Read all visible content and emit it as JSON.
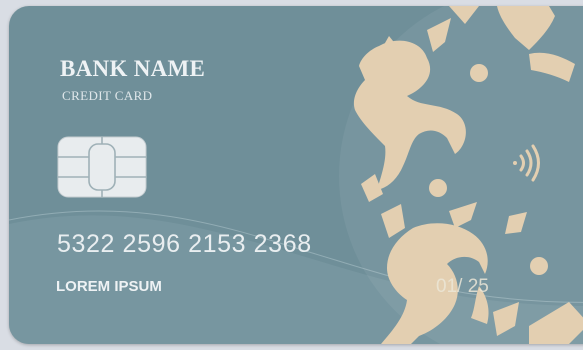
{
  "card": {
    "bank_name": "BANK NAME",
    "card_type": "CREDIT CARD",
    "number": "5322 2596 2153 2368",
    "holder_name": "LOREM IPSUM",
    "expiry": "01/ 25",
    "chip_icon": "emv-chip-icon",
    "contactless_icon": "contactless-payment-icon",
    "colors": {
      "card_background": "#6f8f99",
      "ornament": "#e3cfb1",
      "text": "#eef2f4",
      "chip": "#e8ecee"
    }
  }
}
